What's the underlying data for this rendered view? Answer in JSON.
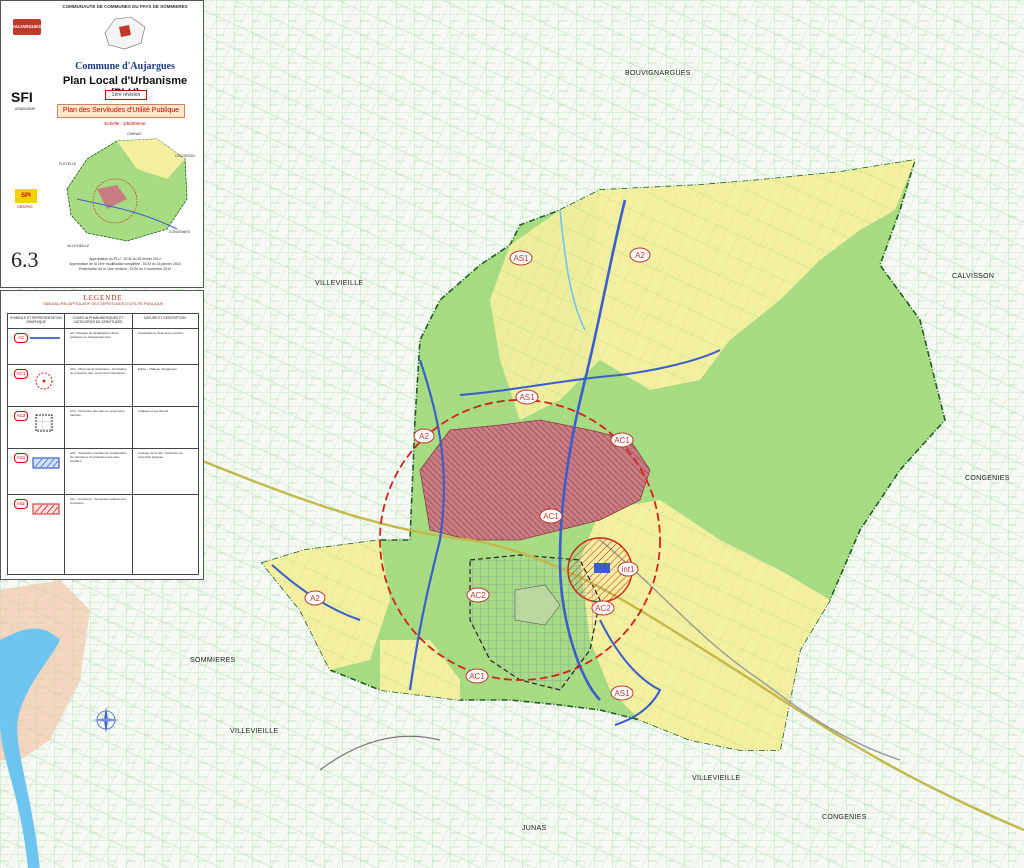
{
  "cartouche": {
    "community": "COMMUNAUTE DE COMMUNES DU PAYS DE SOMMIERES",
    "commune_name": "Commune d'Aujargues",
    "plan_title": "Plan Local d'Urbanisme (PLU)",
    "revision": "1ère révision",
    "sheet_title": "Plan des Servitudes d'Utilité Publique",
    "scale": "Echelle : 1/5000ème",
    "sheet_number": "6.3",
    "logo_text": "AUJARGUES",
    "sfi_label": "SFI",
    "sfi_sub": "URBANISME",
    "spi_label": "SPI",
    "spi_sub": "GRAPHIC",
    "approval_lines": [
      "Approbation du PLU : DCM du 26 février 2014",
      "Approbation de la 1ère modification simplifiée : DCM du 16 janvier 2018",
      "Prescription de la 1ère révision : DCM du 4 novembre 2019"
    ],
    "inset_labels": [
      "CARNAS",
      "FLEVELLE",
      "CALVISSON",
      "CONGENIES",
      "VILLEVIEILLE"
    ]
  },
  "legend": {
    "title": "LEGENDE",
    "subtitle": "TABLEAU RECAPITULATIF DES SERVITUDES D'UTILITE PUBLIQUE",
    "col_symbol": "SYMBOLE ET REPRESENTATION GRAPHIQUE",
    "col_code": "CODES ALPHANUMERIQUES ET CATEGORIES DE SERVITUDES",
    "col_nature": "NATURE ET DESCRIPTION",
    "rows": [
      {
        "code": "A2",
        "color": "#3a6ad0",
        "desc": "A2 - Passage de canalisations d'eau publiques ou d'assainissement",
        "nature": "Canalisations d'eau sous pression"
      },
      {
        "code": "AC1",
        "color": "#c0392b",
        "desc": "AC1 - Monuments historiques - Servitudes de protection des monuments historiques",
        "nature": "Eglise - Château d'Aujargues"
      },
      {
        "code": "AC2",
        "color": "#222222",
        "desc": "AC2 - Protection des sites et monuments naturels",
        "nature": "Château et ses abords"
      },
      {
        "code": "AS1",
        "color": "#3a6ad0",
        "desc": "AS1 - Servitudes résultant de l'instauration de périmètres de protection des eaux potables",
        "nature": "Captage de la ville - Périmètre de protection éloignée"
      },
      {
        "code": "int1",
        "color": "#c0392b",
        "desc": "int1 - Cimetières - Servitudes relatives aux cimetières",
        "nature": ""
      }
    ]
  },
  "map": {
    "communes": [
      "BOUVIGNARGUES",
      "VILLEVIEILLE",
      "CALVISSON",
      "CONGENIES",
      "SOMMIERES",
      "VILLEVIEILLE",
      "VILLEVIEILLE",
      "JUNAS",
      "CONGENIES"
    ],
    "zone_labels": [
      "AS1",
      "A2",
      "AS1",
      "A2",
      "AC1",
      "AC1",
      "A2",
      "AC2",
      "AC2",
      "int1",
      "AC1",
      "AS1"
    ],
    "colors": {
      "urban": "#c97a7a",
      "natural": "#a8dc82",
      "agricultural": "#f5f0a0",
      "servitude_red": "#d42020",
      "water": "#3a5fcc",
      "river": "#6ec6f0",
      "boundary": "#1b5e20"
    }
  }
}
